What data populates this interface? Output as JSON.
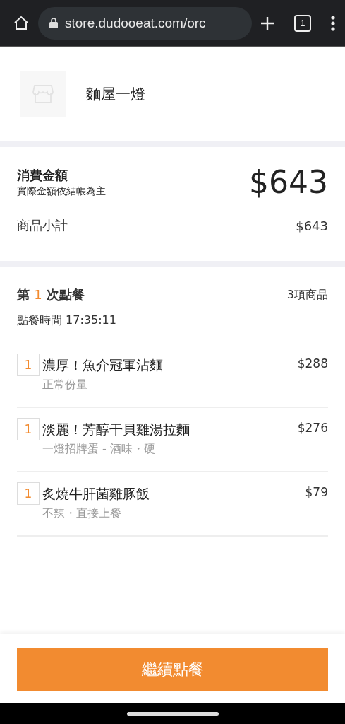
{
  "browser": {
    "url": "store.dudooeat.com/orc",
    "tab_count": "1"
  },
  "store": {
    "name": "麵屋一燈"
  },
  "summary": {
    "title": "消費金額",
    "note": "實際金額依結帳為主",
    "total": "$643",
    "subtotal_label": "商品小計",
    "subtotal": "$643"
  },
  "order": {
    "heading_prefix": "第",
    "heading_number": "1",
    "heading_suffix": "次點餐",
    "item_count": "3項商品",
    "time": "點餐時間 17:35:11",
    "items": [
      {
        "qty": "1",
        "name": "濃厚！魚介冠軍沾麵",
        "options": "正常份量",
        "price": "$288"
      },
      {
        "qty": "1",
        "name": "淡麗！芳醇干貝雞湯拉麵",
        "options": "一燈招牌蛋 - 酒味・硬",
        "price": "$276"
      },
      {
        "qty": "1",
        "name": "炙燒牛肝菌雞豚飯",
        "options": "不辣・直接上餐",
        "price": "$79"
      }
    ]
  },
  "continue_button": "繼續點餐"
}
